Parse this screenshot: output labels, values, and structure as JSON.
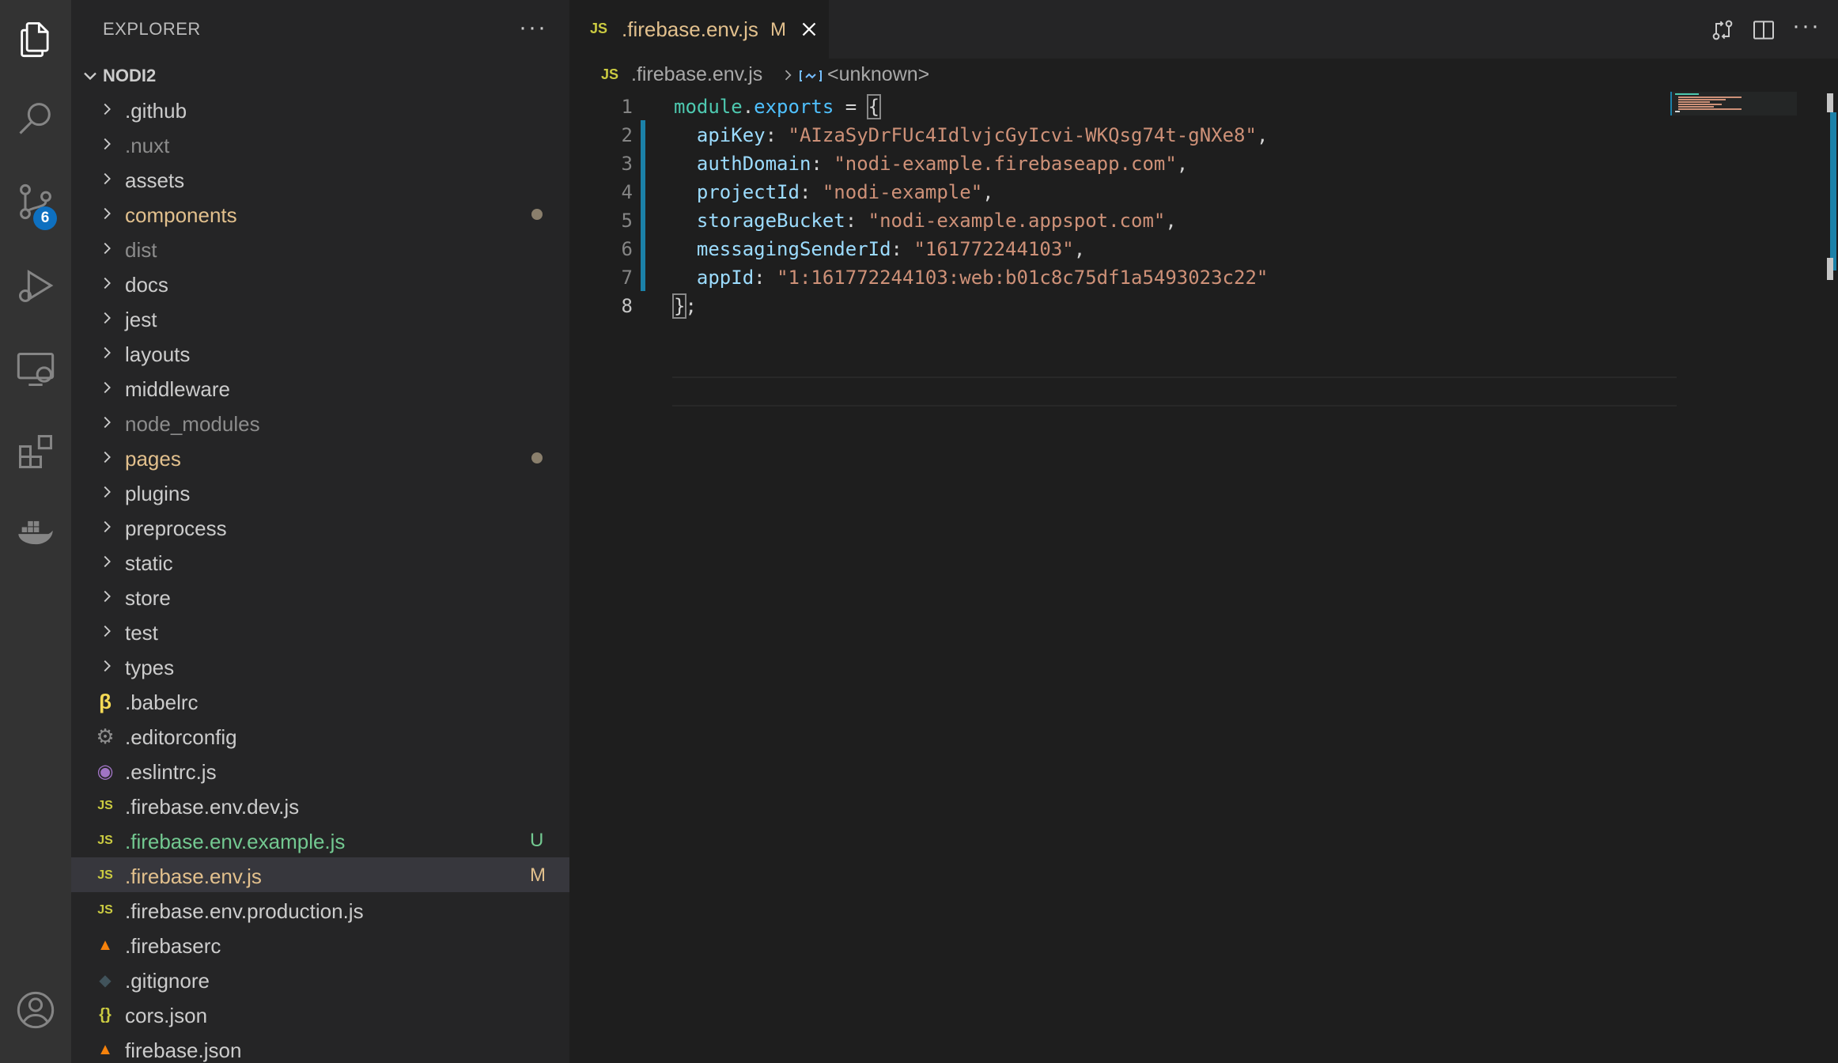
{
  "explorer": {
    "title": "EXPLORER",
    "more": "···",
    "project": "NODI2",
    "items": [
      {
        "name": ".github",
        "type": "folder",
        "color": "#cccccc",
        "deco": ""
      },
      {
        "name": ".nuxt",
        "type": "folder",
        "color": "#8c8c8c",
        "deco": ""
      },
      {
        "name": "assets",
        "type": "folder",
        "color": "#cccccc",
        "deco": ""
      },
      {
        "name": "components",
        "type": "folder",
        "color": "#e2c08d",
        "deco": "dot"
      },
      {
        "name": "dist",
        "type": "folder",
        "color": "#8c8c8c",
        "deco": ""
      },
      {
        "name": "docs",
        "type": "folder",
        "color": "#cccccc",
        "deco": ""
      },
      {
        "name": "jest",
        "type": "folder",
        "color": "#cccccc",
        "deco": ""
      },
      {
        "name": "layouts",
        "type": "folder",
        "color": "#cccccc",
        "deco": ""
      },
      {
        "name": "middleware",
        "type": "folder",
        "color": "#cccccc",
        "deco": ""
      },
      {
        "name": "node_modules",
        "type": "folder",
        "color": "#8c8c8c",
        "deco": ""
      },
      {
        "name": "pages",
        "type": "folder",
        "color": "#e2c08d",
        "deco": "dot"
      },
      {
        "name": "plugins",
        "type": "folder",
        "color": "#cccccc",
        "deco": ""
      },
      {
        "name": "preprocess",
        "type": "folder",
        "color": "#cccccc",
        "deco": ""
      },
      {
        "name": "static",
        "type": "folder",
        "color": "#cccccc",
        "deco": ""
      },
      {
        "name": "store",
        "type": "folder",
        "color": "#cccccc",
        "deco": ""
      },
      {
        "name": "test",
        "type": "folder",
        "color": "#cccccc",
        "deco": ""
      },
      {
        "name": "types",
        "type": "folder",
        "color": "#cccccc",
        "deco": ""
      },
      {
        "name": ".babelrc",
        "type": "file",
        "icon": "babel-icon",
        "color": "#cccccc",
        "deco": ""
      },
      {
        "name": ".editorconfig",
        "type": "file",
        "icon": "gear-icon",
        "color": "#cccccc",
        "deco": ""
      },
      {
        "name": ".eslintrc.js",
        "type": "file",
        "icon": "eslint-icon",
        "color": "#cccccc",
        "deco": ""
      },
      {
        "name": ".firebase.env.dev.js",
        "type": "file",
        "icon": "js-icon",
        "color": "#cccccc",
        "deco": ""
      },
      {
        "name": ".firebase.env.example.js",
        "type": "file",
        "icon": "js-icon",
        "color": "#73c991",
        "deco": "U"
      },
      {
        "name": ".firebase.env.js",
        "type": "file",
        "icon": "js-icon",
        "color": "#e2c08d",
        "deco": "M",
        "selected": true
      },
      {
        "name": ".firebase.env.production.js",
        "type": "file",
        "icon": "js-icon",
        "color": "#cccccc",
        "deco": ""
      },
      {
        "name": ".firebaserc",
        "type": "file",
        "icon": "firebase-icon",
        "color": "#cccccc",
        "deco": ""
      },
      {
        "name": ".gitignore",
        "type": "file",
        "icon": "git-icon",
        "color": "#cccccc",
        "deco": ""
      },
      {
        "name": "cors.json",
        "type": "file",
        "icon": "json-icon",
        "color": "#cccccc",
        "deco": ""
      },
      {
        "name": "firebase.json",
        "type": "file",
        "icon": "firebase-icon",
        "color": "#cccccc",
        "deco": ""
      }
    ]
  },
  "activity": {
    "scm_badge": "6"
  },
  "tab": {
    "lang": "JS",
    "name": ".firebase.env.js",
    "status": "M"
  },
  "breadcrumb": {
    "lang": "JS",
    "file": ".firebase.env.js",
    "symbol": "<unknown>"
  },
  "editor": {
    "lines": [
      {
        "n": "1",
        "tokens": [
          [
            "var",
            "module"
          ],
          [
            "punc",
            "."
          ],
          [
            "prop",
            "exports"
          ],
          [
            "punc",
            " = "
          ],
          [
            "brk",
            "{"
          ]
        ]
      },
      {
        "n": "2",
        "tokens": [
          [
            "punc",
            "  "
          ],
          [
            "key",
            "apiKey"
          ],
          [
            "punc",
            ": "
          ],
          [
            "str",
            "\"AIzaSyDrFUc4IdlvjcGyIcvi-WKQsg74t-gNXe8\""
          ],
          [
            "punc",
            ","
          ]
        ]
      },
      {
        "n": "3",
        "tokens": [
          [
            "punc",
            "  "
          ],
          [
            "key",
            "authDomain"
          ],
          [
            "punc",
            ": "
          ],
          [
            "str",
            "\"nodi-example.firebaseapp.com\""
          ],
          [
            "punc",
            ","
          ]
        ]
      },
      {
        "n": "4",
        "tokens": [
          [
            "punc",
            "  "
          ],
          [
            "key",
            "projectId"
          ],
          [
            "punc",
            ": "
          ],
          [
            "str",
            "\"nodi-example\""
          ],
          [
            "punc",
            ","
          ]
        ]
      },
      {
        "n": "5",
        "tokens": [
          [
            "punc",
            "  "
          ],
          [
            "key",
            "storageBucket"
          ],
          [
            "punc",
            ": "
          ],
          [
            "str",
            "\"nodi-example.appspot.com\""
          ],
          [
            "punc",
            ","
          ]
        ]
      },
      {
        "n": "6",
        "tokens": [
          [
            "punc",
            "  "
          ],
          [
            "key",
            "messagingSenderId"
          ],
          [
            "punc",
            ": "
          ],
          [
            "str",
            "\"161772244103\""
          ],
          [
            "punc",
            ","
          ]
        ]
      },
      {
        "n": "7",
        "tokens": [
          [
            "punc",
            "  "
          ],
          [
            "key",
            "appId"
          ],
          [
            "punc",
            ": "
          ],
          [
            "str",
            "\"1:161772244103:web:b01c8c75df1a5493023c22\""
          ]
        ]
      },
      {
        "n": "8",
        "tokens": [
          [
            "brk",
            "}"
          ],
          [
            "punc",
            ";"
          ]
        ]
      }
    ]
  },
  "colors": {
    "accent": "#0e70c0",
    "modified": "#e2c08d",
    "untracked": "#73c991"
  }
}
